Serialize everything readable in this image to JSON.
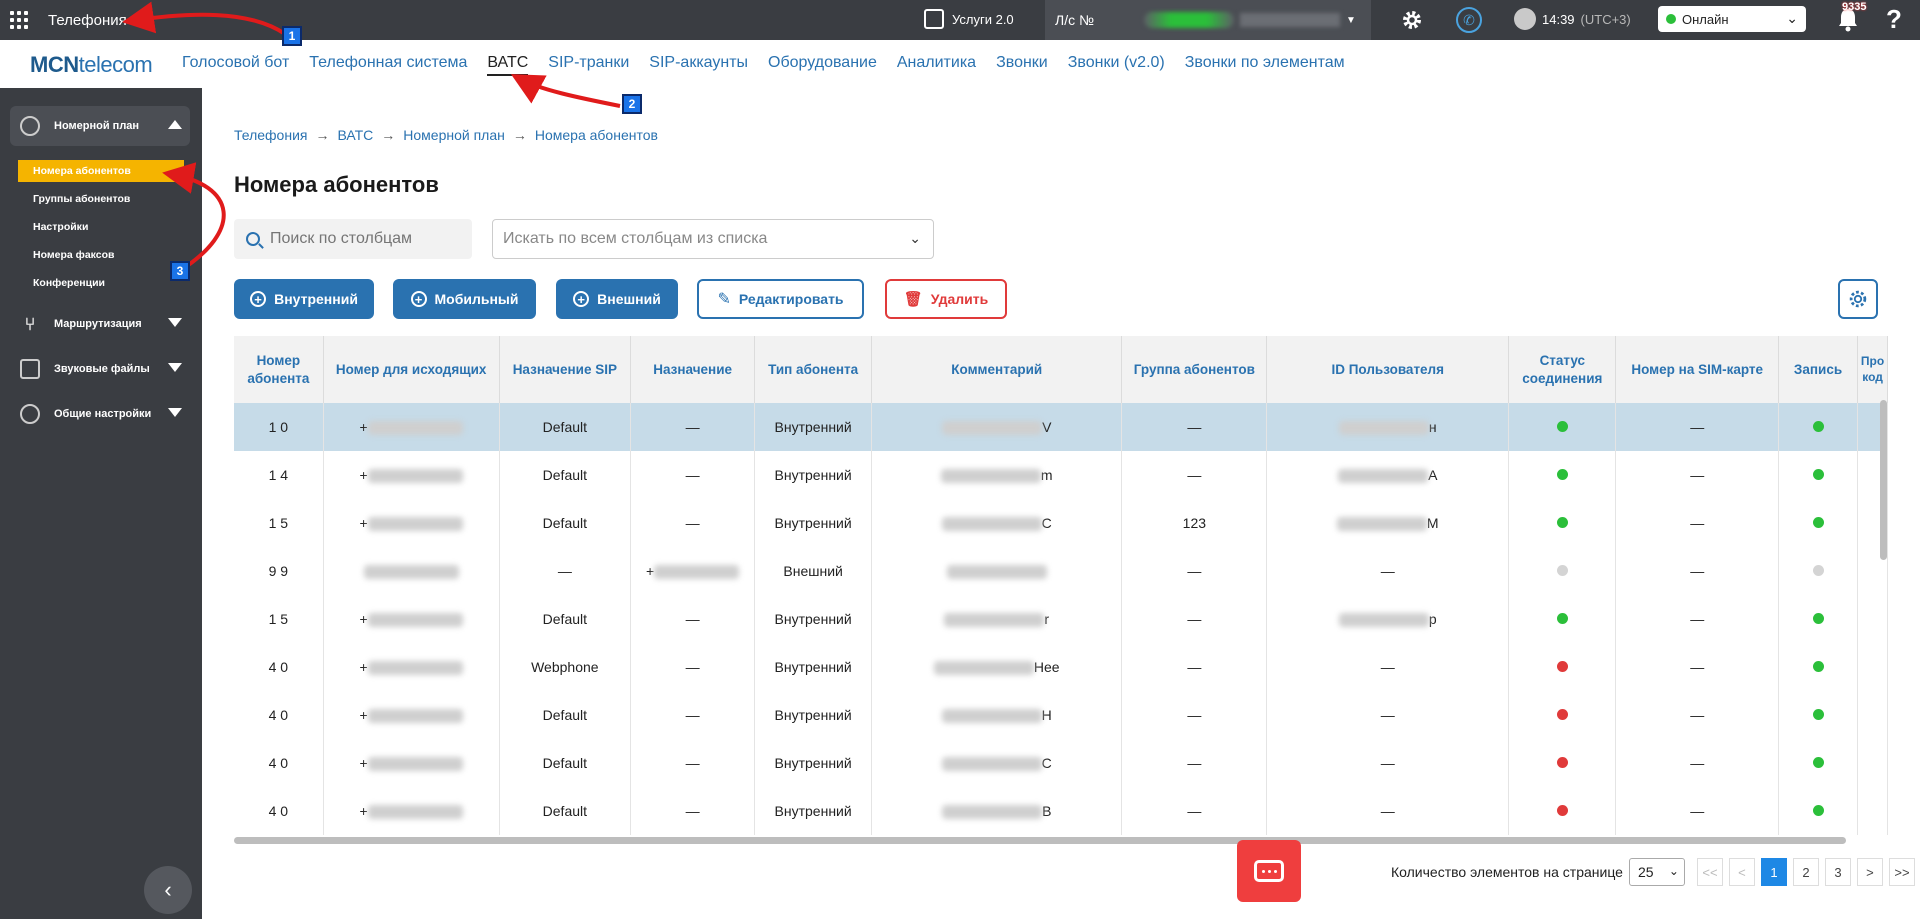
{
  "topbar": {
    "app_title": "Телефония",
    "services_label": "Услуги 2.0",
    "account_prefix": "Л/с №",
    "time": "14:39",
    "timezone": "(UTC+3)",
    "status": "Онлайн",
    "notifications_count": "9335",
    "help": "?"
  },
  "brand": {
    "mcn": "MCN",
    "telecom": "telecom"
  },
  "nav": [
    {
      "label": "Голосовой бот"
    },
    {
      "label": "Телефонная система"
    },
    {
      "label": "ВАТС"
    },
    {
      "label": "SIP-транки"
    },
    {
      "label": "SIP-аккаунты"
    },
    {
      "label": "Оборудование"
    },
    {
      "label": "Аналитика"
    },
    {
      "label": "Звонки"
    },
    {
      "label": "Звонки (v2.0)"
    },
    {
      "label": "Звонки по элементам"
    }
  ],
  "sidebar": {
    "sections": [
      {
        "label": "Номерной план"
      },
      {
        "label": "Маршрутизация"
      },
      {
        "label": "Звуковые файлы"
      },
      {
        "label": "Общие настройки"
      }
    ],
    "items": [
      {
        "label": "Номера абонентов"
      },
      {
        "label": "Группы абонентов"
      },
      {
        "label": "Настройки"
      },
      {
        "label": "Номера факсов"
      },
      {
        "label": "Конференции"
      }
    ]
  },
  "breadcrumb": [
    "Телефония",
    "ВАТС",
    "Номерной план",
    "Номера абонентов"
  ],
  "breadcrumb_sep": "→",
  "page_title": "Номера абонентов",
  "search": {
    "placeholder": "Поиск по столбцам"
  },
  "column_select": {
    "placeholder": "Искать по всем столбцам из списка"
  },
  "buttons": {
    "internal": "Внутренний",
    "mobile": "Мобильный",
    "external": "Внешний",
    "edit": "Редактировать",
    "delete": "Удалить"
  },
  "table": {
    "headers": [
      "Номер абонента",
      "Номер для исходящих",
      "Назначение SIP",
      "Назначение",
      "Тип абонента",
      "Комментарий",
      "Группа абонентов",
      "ID Пользователя",
      "Статус соединения",
      "Номер на SIM-карте",
      "Запись",
      "Про код"
    ],
    "rows": [
      {
        "num": "1 0",
        "out": "+",
        "sip": "Default",
        "dest": "—",
        "type": "Внутренний",
        "comment": "V",
        "group": "—",
        "uid": "н",
        "status": "g",
        "sim": "—",
        "rec": "g"
      },
      {
        "num": "1 4",
        "out": "+",
        "sip": "Default",
        "dest": "—",
        "type": "Внутренний",
        "comment": "m",
        "group": "—",
        "uid": "А",
        "status": "g",
        "sim": "—",
        "rec": "g"
      },
      {
        "num": "1 5",
        "out": "+",
        "sip": "Default",
        "dest": "—",
        "type": "Внутренний",
        "comment": "C",
        "group": "123",
        "uid": "М",
        "status": "g",
        "sim": "—",
        "rec": "g"
      },
      {
        "num": "9 9",
        "out": "",
        "sip": "—",
        "dest": "+",
        "type": "Внешний",
        "comment": "",
        "group": "—",
        "uid": "—",
        "status": "gray",
        "sim": "—",
        "rec": "gray"
      },
      {
        "num": "1 5",
        "out": "+",
        "sip": "Default",
        "dest": "—",
        "type": "Внутренний",
        "comment": "r",
        "group": "—",
        "uid": "р",
        "status": "g",
        "sim": "—",
        "rec": "g"
      },
      {
        "num": "4 0",
        "out": "+",
        "sip": "Webphone",
        "dest": "—",
        "type": "Внутренний",
        "comment": "Hee",
        "group": "—",
        "uid": "—",
        "status": "r",
        "sim": "—",
        "rec": "g"
      },
      {
        "num": "4 0",
        "out": "+",
        "sip": "Default",
        "dest": "—",
        "type": "Внутренний",
        "comment": "H",
        "group": "—",
        "uid": "—",
        "status": "r",
        "sim": "—",
        "rec": "g"
      },
      {
        "num": "4 0",
        "out": "+",
        "sip": "Default",
        "dest": "—",
        "type": "Внутренний",
        "comment": "C",
        "group": "—",
        "uid": "—",
        "status": "r",
        "sim": "—",
        "rec": "g"
      },
      {
        "num": "4 0",
        "out": "+",
        "sip": "Default",
        "dest": "—",
        "type": "Внутренний",
        "comment": "B",
        "group": "—",
        "uid": "—",
        "status": "r",
        "sim": "—",
        "rec": "g"
      }
    ]
  },
  "pagination": {
    "per_page_label": "Количество элементов на странице",
    "per_page": "25",
    "first": "<<",
    "prev": "<",
    "pages": [
      "1",
      "2",
      "3"
    ],
    "next": ">",
    "last": ">>"
  },
  "annotations": [
    "1",
    "2",
    "3"
  ],
  "colors": {
    "accent": "#2a72b0",
    "sidebar": "#3a3d42",
    "active_item": "#f5b400",
    "danger": "#e03a3a",
    "online": "#2bbf3a"
  }
}
